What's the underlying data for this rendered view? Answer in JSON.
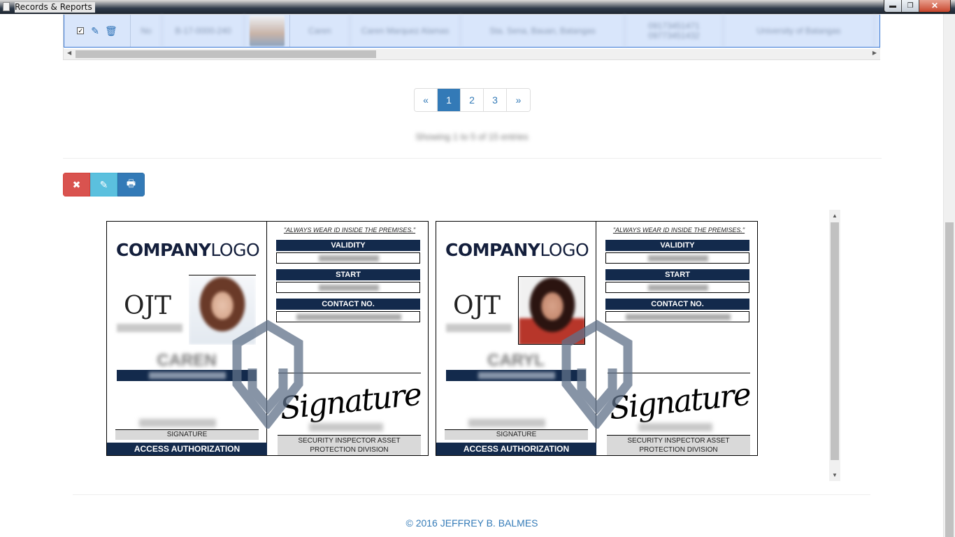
{
  "window": {
    "title": "Records & Reports"
  },
  "window_buttons": {
    "minimize": "▬",
    "maximize": "❐",
    "close": "✕"
  },
  "table": {
    "row": {
      "checkbox": "✓",
      "cells": [
        "No",
        "B-17-0000-240",
        "",
        "Caren",
        "Caren Marquez Alamas",
        "Sta. Sena, Bauan, Batangas",
        "09173451471 09773451432",
        "University of Batangas"
      ]
    },
    "scroll_left": "◀",
    "scroll_right": "▶"
  },
  "pagination": {
    "prev": "«",
    "pages": [
      "1",
      "2",
      "3"
    ],
    "next": "»",
    "active": "1"
  },
  "showing_text": "Showing 1 to 5 of 15 entries",
  "actions": {
    "delete_icon": "✖",
    "edit_icon": "✎",
    "print_icon": "🖶"
  },
  "card_scroll": {
    "up": "▲",
    "down": "▼"
  },
  "id_cards": [
    {
      "logo_bold": "COMPANY",
      "logo_light": "LOGO",
      "type": "OJT",
      "id_number": "B-17-0000-240",
      "name": "CAREN",
      "school": "",
      "signature_name": "Caren Marquez Alamas",
      "signature_label": "SIGNATURE",
      "access_label": "ACCESS AUTHORIZATION",
      "wear_notice": "\"ALWAYS WEAR ID INSIDE THE PREMISES.\"",
      "validity_label": "VALIDITY",
      "validity_value": "",
      "start_label": "START",
      "start_value": "",
      "contact_label": "CONTACT NO.",
      "contact_value": "",
      "script_signature": "Signature",
      "inspector_name": "",
      "inspector_label": "SECURITY INSPECTOR ASSET PROTECTION DIVISION"
    },
    {
      "logo_bold": "COMPANY",
      "logo_light": "LOGO",
      "type": "OJT",
      "id_number": "B-17-0000-241",
      "name": "CARYL",
      "school": "",
      "signature_name": "Caryl Carlo",
      "signature_label": "SIGNATURE",
      "access_label": "ACCESS AUTHORIZATION",
      "wear_notice": "\"ALWAYS WEAR ID INSIDE THE PREMISES.\"",
      "validity_label": "VALIDITY",
      "validity_value": "",
      "start_label": "START",
      "start_value": "",
      "contact_label": "CONTACT NO.",
      "contact_value": "",
      "script_signature": "Signature",
      "inspector_name": "",
      "inspector_label": "SECURITY INSPECTOR ASSET PROTECTION DIVISION"
    }
  ],
  "footer": "© 2016 JEFFREY B. BALMES",
  "colors": {
    "navy": "#132a4c",
    "link": "#337ab7",
    "danger": "#d9534f",
    "info": "#5bc0de"
  }
}
